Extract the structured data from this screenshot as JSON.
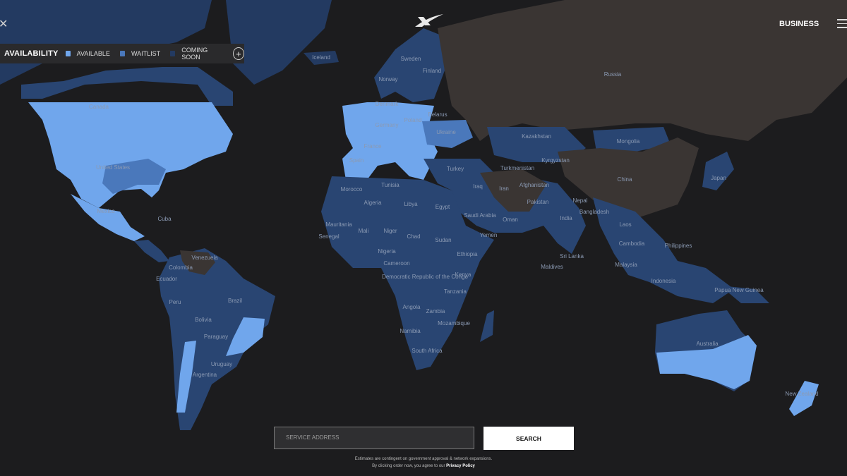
{
  "header": {
    "business_label": "BUSINESS"
  },
  "legend": {
    "title": "AVAILABILITY",
    "items": [
      {
        "label": "AVAILABLE",
        "color": "#70a6ec"
      },
      {
        "label": "WAITLIST",
        "color": "#4a78bb"
      },
      {
        "label": "COMING SOON",
        "color": "#233a61"
      }
    ]
  },
  "map": {
    "colors": {
      "ocean": "#1c1c1e",
      "coming_soon": "#233a61",
      "waitlist": "#4a78bb",
      "available": "#70a6ec",
      "unavailable": "#3a3533"
    },
    "labels": [
      "Iceland",
      "Sweden",
      "Finland",
      "Norway",
      "Canada",
      "Denmark",
      "Belarus",
      "Poland",
      "Germany",
      "Ukraine",
      "France",
      "Spain",
      "Russia",
      "Kazakhstan",
      "Mongolia",
      "Kyrgyzstan",
      "Turkmenistan",
      "Turkey",
      "Iraq",
      "Iran",
      "Afghanistan",
      "China",
      "Japan",
      "Morocco",
      "Tunisia",
      "Algeria",
      "Libya",
      "Egypt",
      "Saudi Arabia",
      "Oman",
      "Yemen",
      "Pakistan",
      "Nepal",
      "Bangladesh",
      "India",
      "Laos",
      "Cambodia",
      "Philippines",
      "Malaysia",
      "Sri Lanka",
      "Maldives",
      "Mauritania",
      "Mali",
      "Niger",
      "Senegal",
      "Chad",
      "Sudan",
      "Nigeria",
      "Ethiopia",
      "Cameroon",
      "Democratic Republic of the Congo",
      "Kenya",
      "Tanzania",
      "Angola",
      "Zambia",
      "Mozambique",
      "Namibia",
      "South Africa",
      "Mexico",
      "United States",
      "Venezuela",
      "Colombia",
      "Ecuador",
      "Peru",
      "Brazil",
      "Bolivia",
      "Paraguay",
      "Uruguay",
      "Argentina",
      "Papua New Guinea",
      "Indonesia",
      "Australia",
      "New Zealand",
      "Cuba"
    ]
  },
  "search": {
    "placeholder": "SERVICE ADDRESS",
    "button_label": "SEARCH"
  },
  "footer": {
    "disclaimer": "Estimates are contingent on government approval & network expansions.",
    "agree_text": "By clicking order now, you agree to our",
    "privacy_link": "Privacy Policy"
  }
}
